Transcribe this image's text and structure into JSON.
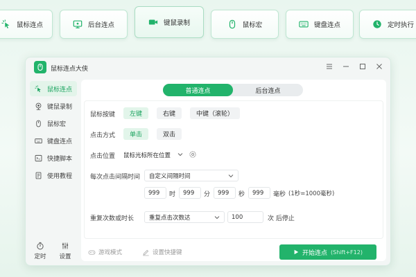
{
  "feature_tabs": [
    {
      "label": "鼠标连点",
      "icon": "cursor-click-icon"
    },
    {
      "label": "后台连点",
      "icon": "monitor-icon"
    },
    {
      "label": "键鼠录制",
      "icon": "video-record-icon"
    },
    {
      "label": "鼠标宏",
      "icon": "mouse-icon"
    },
    {
      "label": "键盘连点",
      "icon": "keyboard-icon"
    },
    {
      "label": "定时执行",
      "icon": "clock-icon"
    }
  ],
  "window": {
    "title": "鼠标连点大侠",
    "controls": [
      "menu-icon",
      "minimize-icon",
      "maximize-icon",
      "close-icon"
    ]
  },
  "sidebar": {
    "items": [
      {
        "label": "鼠标连点",
        "icon": "cursor-click-icon",
        "active": true
      },
      {
        "label": "键鼠录制",
        "icon": "webcam-icon"
      },
      {
        "label": "鼠标宏",
        "icon": "mouse-icon"
      },
      {
        "label": "键盘连点",
        "icon": "keyboard-icon"
      },
      {
        "label": "快捷脚本",
        "icon": "script-icon"
      },
      {
        "label": "使用教程",
        "icon": "book-icon"
      }
    ],
    "bottom": [
      {
        "label": "定时",
        "icon": "stopwatch-icon"
      },
      {
        "label": "设置",
        "icon": "sliders-icon"
      }
    ]
  },
  "mode_switch": {
    "active": "普通连点",
    "inactive": "后台连点"
  },
  "settings": {
    "mouse_button": {
      "label": "鼠标按键",
      "options": [
        "左键",
        "右键",
        "中键（滚轮）"
      ],
      "selected": "左键"
    },
    "click_mode": {
      "label": "点击方式",
      "options": [
        "单击",
        "双击"
      ],
      "selected": "单击"
    },
    "click_position": {
      "label": "点击位置",
      "value": "鼠标光标所在位置"
    },
    "interval": {
      "label": "每次点击间隔时间",
      "mode": "自定义间隔时间",
      "hours": "999",
      "hours_unit": "时",
      "minutes": "999",
      "minutes_unit": "分",
      "seconds": "999",
      "seconds_unit": "秒",
      "ms": "999",
      "ms_unit": "毫秒",
      "note": "(1秒=1000毫秒)"
    },
    "repeat": {
      "label": "重复次数或时长",
      "mode": "重复点击次数达",
      "count": "100",
      "suffix": "次 后停止"
    }
  },
  "footer": {
    "game_mode": "游戏模式",
    "hotkey": "设置快捷键",
    "start_label": "开始连点",
    "start_hint": "(Shift+F12)"
  },
  "colors": {
    "accent": "#22b36b",
    "accent_light": "#e2f5ea",
    "window_bg": "#f3f6f5"
  }
}
